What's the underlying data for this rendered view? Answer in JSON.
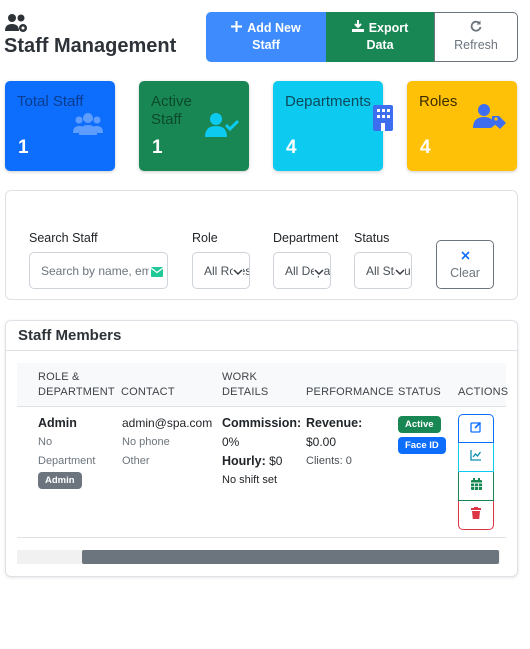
{
  "header": {
    "title": "Staff Management",
    "add_label": "Add New Staff",
    "export_label": "Export Data",
    "refresh_label": "Refresh"
  },
  "stats": [
    {
      "label": "Total Staff",
      "value": "1",
      "icon": "users-icon"
    },
    {
      "label": "Active Staff",
      "value": "1",
      "icon": "user-check-icon"
    },
    {
      "label": "Departments",
      "value": "4",
      "icon": "building-icon"
    },
    {
      "label": "Roles",
      "value": "4",
      "icon": "user-tag-icon"
    }
  ],
  "filters": {
    "search_label": "Search Staff",
    "search_placeholder": "Search by name, email",
    "role_label": "Role",
    "role_value": "All Roles",
    "department_label": "Department",
    "department_value": "All Departments",
    "status_label": "Status",
    "status_value": "All Status",
    "clear_label": "Clear"
  },
  "table": {
    "title": "Staff Members",
    "columns": [
      "ROLE & DEPARTMENT",
      "CONTACT",
      "WORK DETAILS",
      "PERFORMANCE",
      "STATUS",
      "ACTIONS"
    ],
    "rows": [
      {
        "role": "Admin",
        "department_line1": "No",
        "department_line2": "Department",
        "role_badge": "Admin",
        "email": "admin@spa.com",
        "phone": "No phone",
        "contact_type": "Other",
        "commission_label": "Commission:",
        "commission_value": "0%",
        "hourly_label": "Hourly:",
        "hourly_value": "$0",
        "shift": "No shift set",
        "revenue_label": "Revenue:",
        "revenue_value": "$0.00",
        "clients": "Clients: 0",
        "status": "Active",
        "face_id": "Face ID"
      }
    ]
  },
  "colors": {
    "primary": "#0d6efd",
    "success": "#198754",
    "info": "#0dcaf0",
    "warning": "#ffc107",
    "danger": "#dc3545",
    "secondary": "#6c757d"
  }
}
